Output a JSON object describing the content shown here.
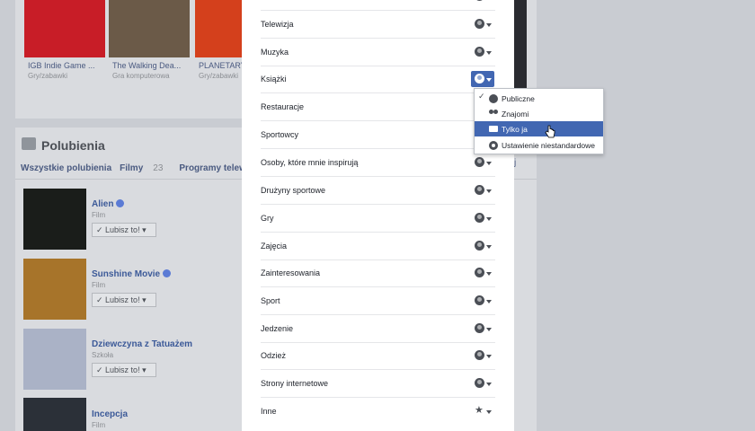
{
  "background": {
    "games": [
      {
        "title": "IGB Indie Game ...",
        "category": "Gry/zabawki",
        "thumb_color": "#c81d27"
      },
      {
        "title": "The Walking Dea...",
        "category": "Gra komputerowa",
        "thumb_color": "#6b5a48"
      },
      {
        "title": "PLANETARY",
        "category": "Gry/zabawki",
        "thumb_color": "#d4401c"
      }
    ],
    "likes": {
      "title": "Polubienia",
      "tabs": [
        {
          "label": "Wszystkie polubienia"
        },
        {
          "label": "Filmy",
          "count": "23"
        },
        {
          "label": "Programy telewizyjne"
        }
      ],
      "right_tab_fragment": "j",
      "items": [
        {
          "name": "Alien",
          "type": "Film",
          "verified": true,
          "button": "Lubisz to! ▾",
          "thumb_color": "#1a1d1a"
        },
        {
          "name": "Sunshine Movie",
          "type": "Film",
          "verified": true,
          "button": "Lubisz to! ▾",
          "thumb_color": "#a7742a"
        },
        {
          "name": "Dziewczyna z Tatuażem",
          "type": "Szkoła",
          "verified": false,
          "button": "Lubisz to! ▾",
          "thumb_color": "#aab2c6"
        },
        {
          "name": "Incepcja",
          "type": "Film",
          "verified": false,
          "button": "",
          "thumb_color": "#2b3038"
        }
      ]
    }
  },
  "panel": {
    "rows": [
      {
        "label": "Telewizja",
        "audience": "globe"
      },
      {
        "label": "Muzyka",
        "audience": "globe"
      },
      {
        "label": "Książki",
        "audience": "globe",
        "active": true
      },
      {
        "label": "Restauracje",
        "audience": "none"
      },
      {
        "label": "Sportowcy",
        "audience": "none"
      },
      {
        "label": "Osoby, które mnie inspirują",
        "audience": "globe"
      },
      {
        "label": "Drużyny sportowe",
        "audience": "globe"
      },
      {
        "label": "Gry",
        "audience": "globe"
      },
      {
        "label": "Zajęcia",
        "audience": "globe"
      },
      {
        "label": "Zainteresowania",
        "audience": "globe"
      },
      {
        "label": "Sport",
        "audience": "globe"
      },
      {
        "label": "Jedzenie",
        "audience": "globe"
      },
      {
        "label": "Odzież",
        "audience": "globe"
      },
      {
        "label": "Strony internetowe",
        "audience": "globe"
      },
      {
        "label": "Inne",
        "audience": "star"
      }
    ]
  },
  "dropdown": {
    "options": [
      {
        "label": "Publiczne",
        "icon": "globe-icon",
        "checked": true,
        "selected": false
      },
      {
        "label": "Znajomi",
        "icon": "friends-icon",
        "checked": false,
        "selected": false
      },
      {
        "label": "Tylko ja",
        "icon": "lock-icon",
        "checked": false,
        "selected": true
      },
      {
        "label": "Ustawienie niestandardowe",
        "icon": "gear-icon",
        "checked": false,
        "selected": false
      }
    ]
  },
  "colors": {
    "accent": "#4267b2",
    "link": "#3b5998"
  }
}
